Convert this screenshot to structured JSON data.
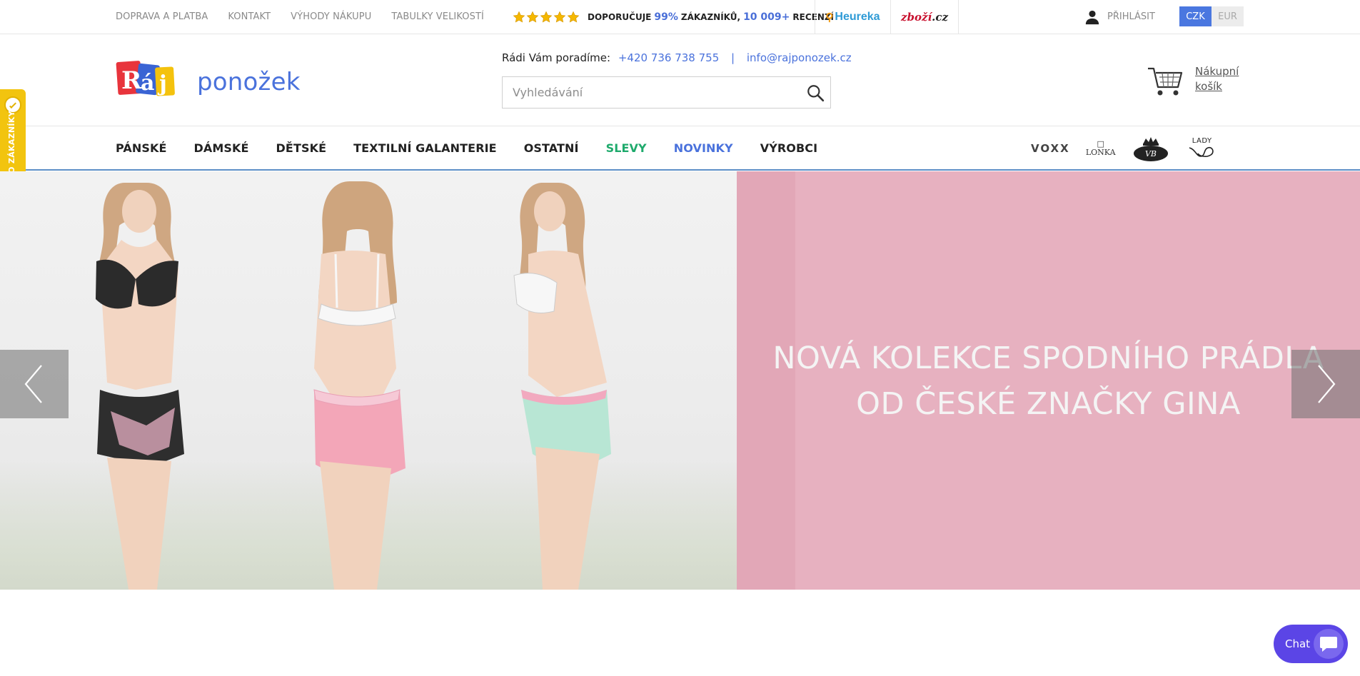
{
  "topbar": {
    "links": [
      "DOPRAVA A PLATBA",
      "KONTAKT",
      "VÝHODY NÁKUPU",
      "TABULKY VELIKOSTÍ"
    ],
    "rating": {
      "stars": 5,
      "prefix": "DOPORUČUJE",
      "percent": "99%",
      "middle": "ZÁKAZNÍKŮ,",
      "count": "10 009+",
      "suffix": "RECENZÍ"
    },
    "heureka": "Heureka",
    "zbozi_main": "zboží",
    "zbozi_tld": ".cz",
    "login": "PŘIHLÁSIT",
    "currencies": [
      "CZK",
      "EUR"
    ],
    "active_currency": "CZK"
  },
  "header": {
    "logo_mark": "Ráj",
    "logo_word": "ponožek",
    "contact_label": "Rádi Vám poradíme:",
    "phone": "+420 736 738 755",
    "separator": "|",
    "email": "info@rajponozek.cz",
    "search_placeholder": "Vyhledávání",
    "cart_label": "Nákupní košík"
  },
  "nav": {
    "items": [
      "PÁNSKÉ",
      "DÁMSKÉ",
      "DĚTSKÉ",
      "TEXTILNÍ GALANTERIE",
      "OSTATNÍ",
      "SLEVY",
      "NOVINKY",
      "VÝROBCI"
    ],
    "brands": [
      "VOXX",
      "LONKA",
      "crown-logo",
      "LADY"
    ]
  },
  "badge": {
    "text": "OVĚŘENO ZÁKAZNÍKY"
  },
  "hero": {
    "caption_line1": "NOVÁ KOLEKCE SPODNÍHO PRÁDLA",
    "caption_line2": "OD ČESKÉ ZNAČKY GINA"
  },
  "chat": {
    "label": "Chat"
  },
  "colors": {
    "accent_blue": "#4a72dc",
    "sale_green": "#1eaa6c",
    "badge_yellow": "#f2c40f",
    "hero_pink": "#e7b1c0",
    "chat_purple": "#5b45e6"
  }
}
